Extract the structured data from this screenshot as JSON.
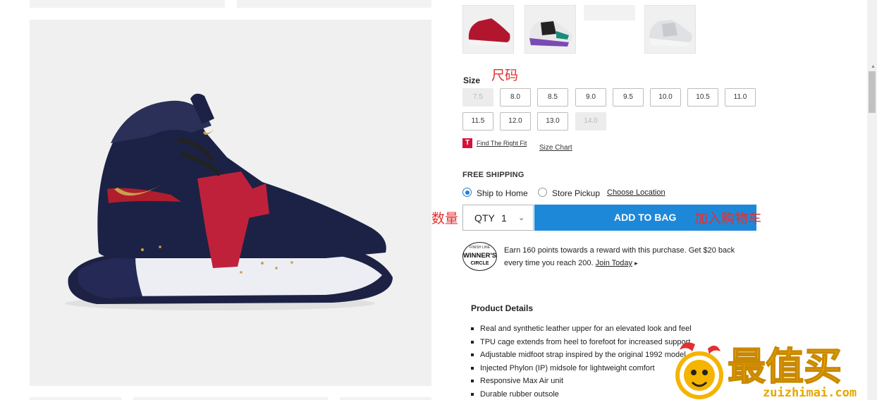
{
  "gallery": {
    "main_image_alt": "Nike Air Force 270 sneaker, obsidian / university red / metallic gold"
  },
  "swatches": [
    {
      "name": "red-white"
    },
    {
      "name": "white-black-teal"
    },
    {
      "name": "blank"
    },
    {
      "name": "white-grey"
    }
  ],
  "size": {
    "label": "Size",
    "annotation_cn": "尺码",
    "options": [
      {
        "label": "7.5",
        "available": false
      },
      {
        "label": "8.0",
        "available": true
      },
      {
        "label": "8.5",
        "available": true
      },
      {
        "label": "9.0",
        "available": true
      },
      {
        "label": "9.5",
        "available": true
      },
      {
        "label": "10.0",
        "available": true
      },
      {
        "label": "10.5",
        "available": true
      },
      {
        "label": "11.0",
        "available": true
      },
      {
        "label": "11.5",
        "available": true
      },
      {
        "label": "12.0",
        "available": true
      },
      {
        "label": "13.0",
        "available": true
      },
      {
        "label": "14.0",
        "available": false
      }
    ],
    "fit_logo": "T",
    "fit_link": "Find The Right Fit",
    "size_chart": "Size Chart"
  },
  "shipping": {
    "title": "FREE SHIPPING",
    "ship_to_home": "Ship to Home",
    "store_pickup": "Store Pickup",
    "choose_location": "Choose Location",
    "selected": "ship_to_home"
  },
  "purchase": {
    "qty_annotation_cn": "数量",
    "qty_label": "QTY",
    "qty_value": "1",
    "add_to_bag": "ADD TO BAG",
    "add_annotation_cn": "加入购物车",
    "button_color": "#1e88d8"
  },
  "rewards": {
    "badge_top": "FINISH LINE",
    "badge_main": "WINNER'S",
    "badge_bottom": "CIRCLE",
    "line1": "Earn 160 points towards a reward with this purchase. Get $20 back",
    "line2": "every time you reach 200.",
    "join_link": "Join Today"
  },
  "details": {
    "title": "Product Details",
    "items": [
      "Real and synthetic leather upper for an elevated look and feel",
      "TPU cage extends from heel to forefoot for increased support",
      "Adjustable midfoot strap inspired by the original 1992 model",
      "Injected Phylon (IP) midsole for lightweight comfort",
      "Responsive Max Air unit",
      "Durable rubber outsole"
    ]
  },
  "watermark": {
    "logo_cn": "最值买",
    "url": "zuizhimai.com",
    "color": "#f5b400"
  },
  "colors": {
    "annotation": "#e23030",
    "accent": "#1e88d8"
  }
}
